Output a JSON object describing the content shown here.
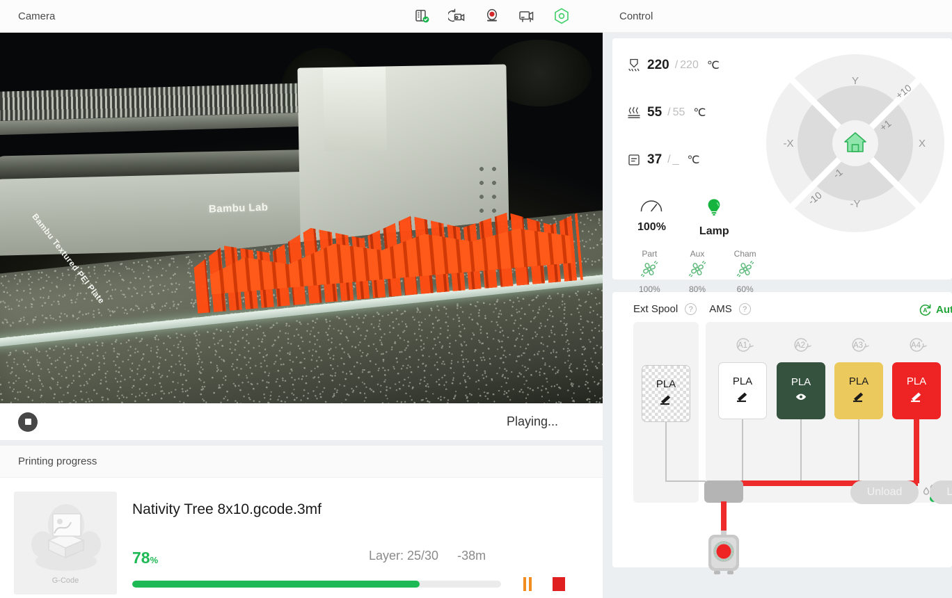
{
  "camera": {
    "title": "Camera",
    "icons": [
      {
        "name": "device-status-icon"
      },
      {
        "name": "timelapse-icon"
      },
      {
        "name": "record-icon"
      },
      {
        "name": "video-camera-icon"
      },
      {
        "name": "nozzle-hexagon-icon"
      }
    ],
    "status_text": "Playing...",
    "stop_button_label": "",
    "feed_overlay_text": "Bambu Lab",
    "plate_text": "Bambu Textured PEI Plate"
  },
  "progress": {
    "header": "Printing progress",
    "thumbnail_label": "G-Code",
    "job_name": "Nativity Tree 8x10.gcode.3mf",
    "percent": "78",
    "percent_symbol": "%",
    "percent_value": 78,
    "layer": "Layer: 25/30",
    "eta": "-38m",
    "progress_color": "#1db954",
    "pause_color": "#f08c20",
    "stop_color": "#e02020"
  },
  "control": {
    "header": "Control",
    "temperatures": [
      {
        "icon": "nozzle-icon",
        "current": "220",
        "separator": "/",
        "target": "220",
        "unit": "℃"
      },
      {
        "icon": "bed-icon",
        "current": "55",
        "separator": "/",
        "target": "55",
        "unit": "℃"
      },
      {
        "icon": "chamber-icon",
        "current": "37",
        "separator": "/",
        "target": "_",
        "unit": "℃"
      }
    ],
    "speed": {
      "icon": "speed-gauge-icon",
      "label": "100%"
    },
    "lamp": {
      "icon": "lamp-bulb-icon",
      "label": "Lamp",
      "color": "#1db954"
    },
    "fans": [
      {
        "name": "Part",
        "value": "100%"
      },
      {
        "name": "Aux",
        "value": "80%"
      },
      {
        "name": "Cham",
        "value": "60%"
      }
    ],
    "axis": {
      "y_plus": "Y",
      "y_minus": "-Y",
      "x_plus": "X",
      "x_minus": "-X",
      "step_plus_10": "+10",
      "step_plus_1": "+1",
      "step_minus_1": "-1",
      "step_minus_10": "-10",
      "home_icon": "home-icon"
    }
  },
  "ams": {
    "ext_spool_label": "Ext Spool",
    "ams_label": "AMS",
    "help_symbol": "?",
    "auto_refill_label": "Auto Refill",
    "auto_refill_color": "#22a53a",
    "ext_spool": {
      "slot": "",
      "material": "PLA",
      "color": "transparent",
      "text_color": "#1a1a1a"
    },
    "slots": [
      {
        "slot": "A1",
        "material": "PLA",
        "color": "#ffffff",
        "text_color": "#1a1a1a",
        "icon": "pencil-icon",
        "active": true
      },
      {
        "slot": "A2",
        "material": "PLA",
        "color": "#35523f",
        "text_color": "#ffffff",
        "icon": "eye-icon",
        "active": false
      },
      {
        "slot": "A3",
        "material": "PLA",
        "color": "#ecc95c",
        "text_color": "#1a1a1a",
        "icon": "pencil-icon",
        "active": false
      },
      {
        "slot": "A4",
        "material": "PLA",
        "color": "#ee2424",
        "text_color": "#ffffff",
        "icon": "pencil-icon",
        "active": false
      }
    ],
    "active_filament_color": "#ee2b2b",
    "humidity_icon": "humidity-thermometer-icon",
    "buttons": [
      {
        "label": "Unload",
        "name": "unload-button"
      },
      {
        "label": "Load",
        "name": "load-button"
      }
    ]
  }
}
